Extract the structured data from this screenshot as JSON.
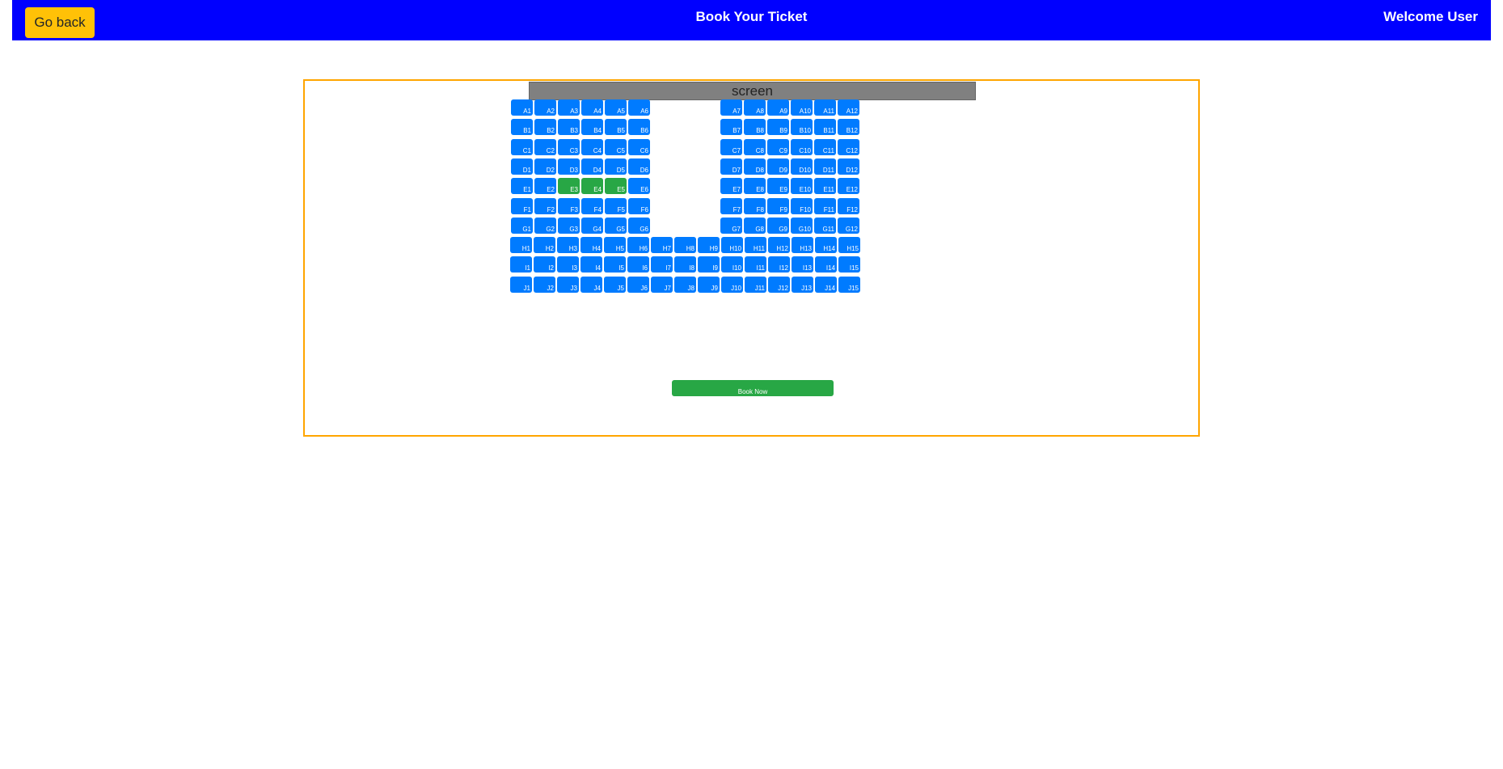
{
  "header": {
    "go_back_label": "Go back",
    "title": "Book Your Ticket",
    "welcome": "Welcome User"
  },
  "screen_label": "screen",
  "book_now_label": "Book Now",
  "colors": {
    "header_bg": "#0000ff",
    "go_back_bg": "#ffc107",
    "seat_available": "#007bff",
    "seat_selected": "#28a745",
    "box_border": "#ffa500"
  },
  "rows": [
    {
      "row": "A",
      "seats": [
        "A1",
        "A2",
        "A3",
        "A4",
        "A5",
        "A6",
        "A7",
        "A8",
        "A9",
        "A10",
        "A11",
        "A12"
      ]
    },
    {
      "row": "B",
      "seats": [
        "B1",
        "B2",
        "B3",
        "B4",
        "B5",
        "B6",
        "B7",
        "B8",
        "B9",
        "B10",
        "B11",
        "B12"
      ]
    },
    {
      "row": "C",
      "seats": [
        "C1",
        "C2",
        "C3",
        "C4",
        "C5",
        "C6",
        "C7",
        "C8",
        "C9",
        "C10",
        "C11",
        "C12"
      ]
    },
    {
      "row": "D",
      "seats": [
        "D1",
        "D2",
        "D3",
        "D4",
        "D5",
        "D6",
        "D7",
        "D8",
        "D9",
        "D10",
        "D11",
        "D12"
      ]
    },
    {
      "row": "E",
      "seats": [
        "E1",
        "E2",
        "E3",
        "E4",
        "E5",
        "E6",
        "E7",
        "E8",
        "E9",
        "E10",
        "E11",
        "E12"
      ]
    },
    {
      "row": "F",
      "seats": [
        "F1",
        "F2",
        "F3",
        "F4",
        "F5",
        "F6",
        "F7",
        "F8",
        "F9",
        "F10",
        "F11",
        "F12"
      ]
    },
    {
      "row": "G",
      "seats": [
        "G1",
        "G2",
        "G3",
        "G4",
        "G5",
        "G6",
        "G7",
        "G8",
        "G9",
        "G10",
        "G11",
        "G12"
      ]
    },
    {
      "row": "H",
      "seats": [
        "H1",
        "H2",
        "H3",
        "H4",
        "H5",
        "H6",
        "H7",
        "H8",
        "H9",
        "H10",
        "H11",
        "H12",
        "H13",
        "H14",
        "H15"
      ]
    },
    {
      "row": "I",
      "seats": [
        "I1",
        "I2",
        "I3",
        "I4",
        "I5",
        "I6",
        "I7",
        "I8",
        "I9",
        "I10",
        "I11",
        "I12",
        "I13",
        "I14",
        "I15"
      ]
    },
    {
      "row": "J",
      "seats": [
        "J1",
        "J2",
        "J3",
        "J4",
        "J5",
        "J6",
        "J7",
        "J8",
        "J9",
        "J10",
        "J11",
        "J12",
        "J13",
        "J14",
        "J15"
      ]
    }
  ],
  "selected_seats": [
    "E3",
    "E4",
    "E5"
  ]
}
